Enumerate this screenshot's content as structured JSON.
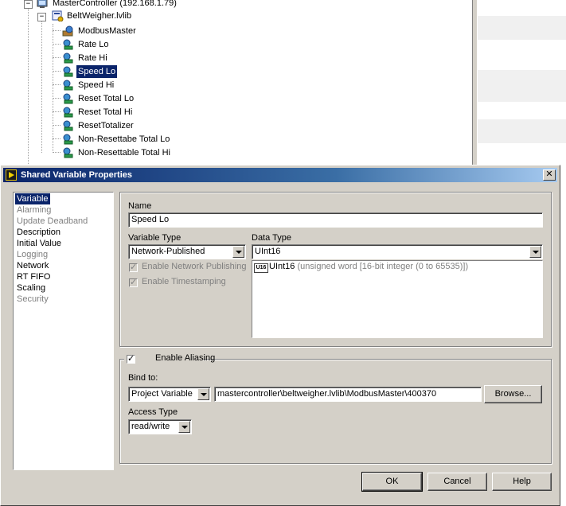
{
  "project_tree": {
    "items": [
      {
        "label": "MasterController (192.168.1.79)",
        "icon": "target-computer-icon"
      },
      {
        "label": "BeltWeigher.lvlib",
        "icon": "library-icon"
      },
      {
        "label": "ModbusMaster",
        "icon": "io-server-icon"
      },
      {
        "label": "Rate Lo",
        "icon": "shared-variable-icon"
      },
      {
        "label": "Rate Hi",
        "icon": "shared-variable-icon"
      },
      {
        "label": "Speed Lo",
        "icon": "shared-variable-icon"
      },
      {
        "label": "Speed Hi",
        "icon": "shared-variable-icon"
      },
      {
        "label": "Reset Total Lo",
        "icon": "shared-variable-icon"
      },
      {
        "label": "Reset Total Hi",
        "icon": "shared-variable-icon"
      },
      {
        "label": "ResetTotalizer",
        "icon": "shared-variable-icon"
      },
      {
        "label": "Non-Resettabe Total Lo",
        "icon": "shared-variable-icon"
      },
      {
        "label": "Non-Resettable Total Hi",
        "icon": "shared-variable-icon"
      }
    ],
    "selected_index": 5
  },
  "dialog": {
    "title": "Shared Variable Properties",
    "close_symbol": "✕",
    "categories": [
      {
        "label": "Variable",
        "state": "selected"
      },
      {
        "label": "Alarming",
        "state": "disabled"
      },
      {
        "label": "Update Deadband",
        "state": "disabled"
      },
      {
        "label": "Description",
        "state": "enabled"
      },
      {
        "label": "Initial Value",
        "state": "enabled"
      },
      {
        "label": "Logging",
        "state": "disabled"
      },
      {
        "label": "Network",
        "state": "enabled"
      },
      {
        "label": "RT FIFO",
        "state": "enabled"
      },
      {
        "label": "Scaling",
        "state": "enabled"
      },
      {
        "label": "Security",
        "state": "disabled"
      }
    ],
    "name_label": "Name",
    "name_value": "Speed Lo",
    "variable_type_label": "Variable Type",
    "variable_type_value": "Network-Published",
    "data_type_label": "Data Type",
    "data_type_value": "UInt16",
    "enable_network_publishing_label": "Enable Network Publishing",
    "enable_network_publishing_checked": true,
    "enable_timestamping_label": "Enable Timestamping",
    "enable_timestamping_checked": true,
    "type_detail_tag": "U16",
    "type_detail_name": "UInt16",
    "type_detail_desc": "(unsigned word [16-bit integer (0 to 65535)])",
    "enable_aliasing_label": "Enable Aliasing",
    "enable_aliasing_checked": true,
    "bind_to_label": "Bind to:",
    "bind_source_value": "Project Variable",
    "bind_path_value": "mastercontroller\\beltweigher.lvlib\\ModbusMaster\\400370",
    "browse_label": "Browse...",
    "access_type_label": "Access Type",
    "access_type_value": "read/write",
    "ok_label": "OK",
    "cancel_label": "Cancel",
    "help_label": "Help"
  },
  "colors": {
    "selection": "#0a246a",
    "dialog_face": "#d4d0c8",
    "disabled_text": "#808080"
  }
}
